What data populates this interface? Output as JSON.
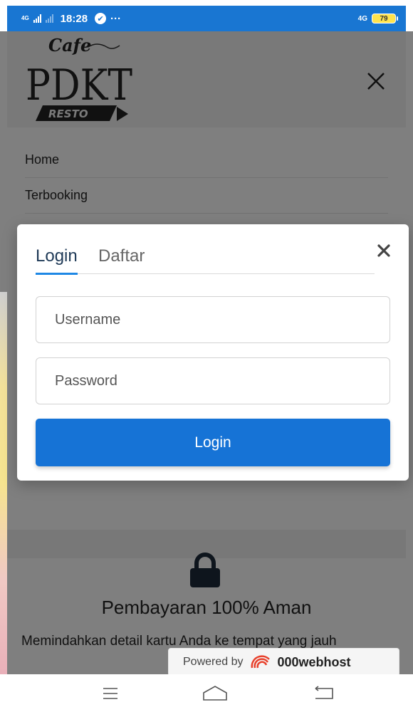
{
  "status_bar": {
    "network_left": "4G",
    "time": "18:28",
    "more": "···",
    "network_right": "4G",
    "battery": "79"
  },
  "header": {
    "logo": {
      "top_word": "Cafe",
      "main_word": "PDKT",
      "bottom_word": "RESTO"
    }
  },
  "nav": {
    "items": [
      {
        "label": "Home"
      },
      {
        "label": "Terbooking"
      }
    ]
  },
  "login_modal": {
    "tabs": [
      {
        "label": "Login",
        "active": true
      },
      {
        "label": "Daftar",
        "active": false
      }
    ],
    "username": {
      "placeholder": "Username",
      "value": ""
    },
    "password": {
      "placeholder": "Password",
      "value": ""
    },
    "submit_label": "Login"
  },
  "payment_section": {
    "icon": "lock-icon",
    "title": "Pembayaran 100% Aman",
    "description": "Memindahkan detail kartu Anda ke tempat yang jauh"
  },
  "powered_badge": {
    "prefix": "Powered by",
    "brand": "000webhost"
  },
  "system_nav": {
    "menu_icon": "menu-icon",
    "home_icon": "home-icon",
    "back_icon": "back-icon"
  },
  "colors": {
    "status_bar": "#1976d2",
    "primary_button": "#1673d6",
    "tab_underline": "#1e88e5",
    "overlay": "rgba(0,0,0,0.5)"
  }
}
